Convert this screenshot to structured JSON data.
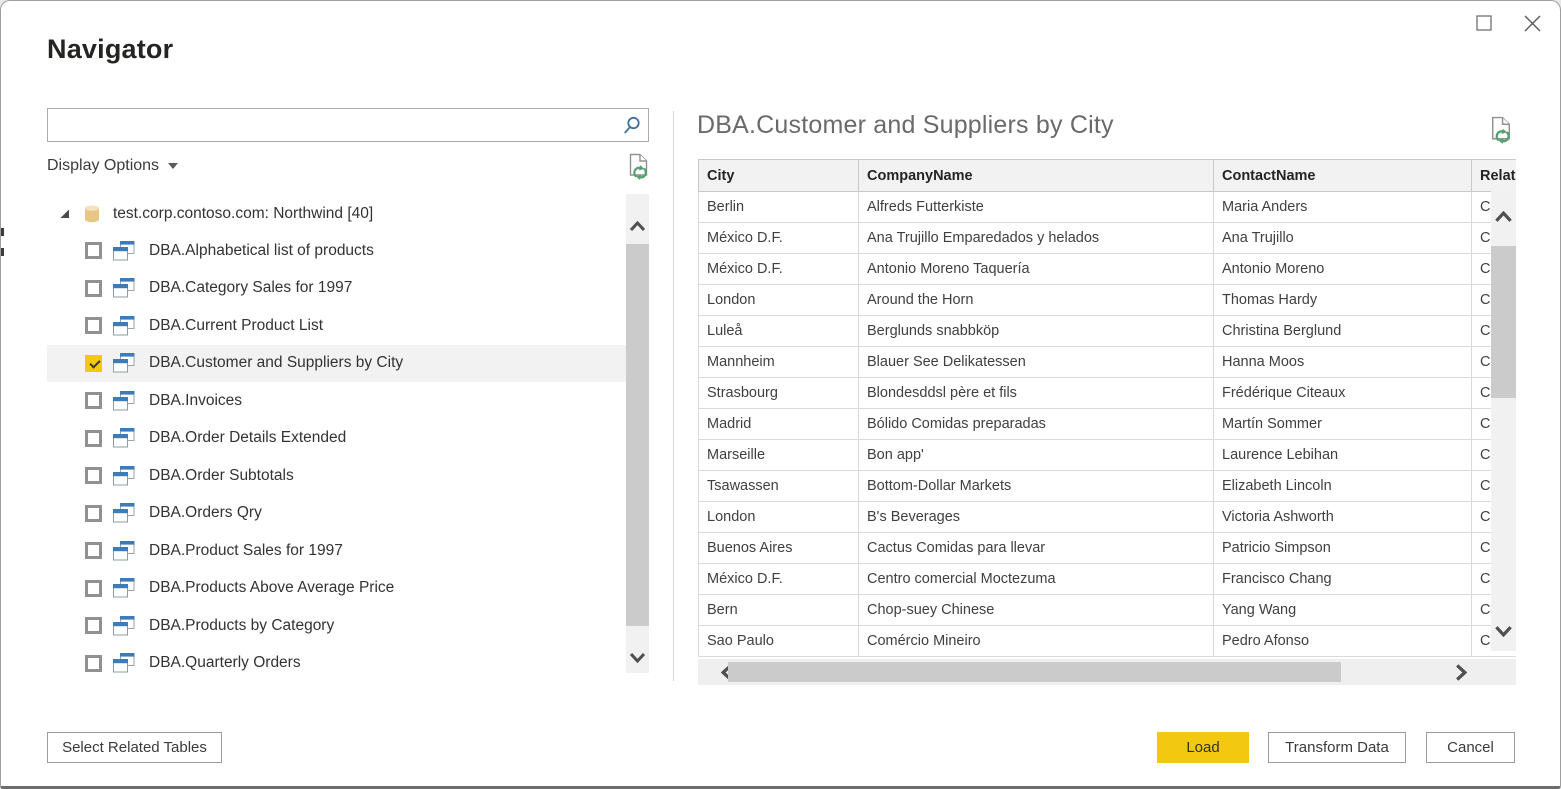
{
  "window": {
    "title": "Navigator"
  },
  "left_panel": {
    "search": {
      "value": "",
      "placeholder": ""
    },
    "display_options_label": "Display Options",
    "tree": {
      "root": {
        "label": "test.corp.contoso.com: Northwind [40]",
        "expanded": true
      },
      "items": [
        {
          "label": "DBA.Alphabetical list of products",
          "checked": false,
          "selected": false
        },
        {
          "label": "DBA.Category Sales for 1997",
          "checked": false,
          "selected": false
        },
        {
          "label": "DBA.Current Product List",
          "checked": false,
          "selected": false
        },
        {
          "label": "DBA.Customer and Suppliers by City",
          "checked": true,
          "selected": true
        },
        {
          "label": "DBA.Invoices",
          "checked": false,
          "selected": false
        },
        {
          "label": "DBA.Order Details Extended",
          "checked": false,
          "selected": false
        },
        {
          "label": "DBA.Order Subtotals",
          "checked": false,
          "selected": false
        },
        {
          "label": "DBA.Orders Qry",
          "checked": false,
          "selected": false
        },
        {
          "label": "DBA.Product Sales for 1997",
          "checked": false,
          "selected": false
        },
        {
          "label": "DBA.Products Above Average Price",
          "checked": false,
          "selected": false
        },
        {
          "label": "DBA.Products by Category",
          "checked": false,
          "selected": false
        },
        {
          "label": "DBA.Quarterly Orders",
          "checked": false,
          "selected": false
        }
      ]
    }
  },
  "preview": {
    "title": "DBA.Customer and Suppliers by City",
    "table": {
      "columns": [
        "City",
        "CompanyName",
        "ContactName",
        "Relati"
      ],
      "rows": [
        [
          "Berlin",
          "Alfreds Futterkiste",
          "Maria Anders",
          "Cu"
        ],
        [
          "México D.F.",
          "Ana Trujillo Emparedados y helados",
          "Ana Trujillo",
          "Cu"
        ],
        [
          "México D.F.",
          "Antonio Moreno Taquería",
          "Antonio Moreno",
          "Cu"
        ],
        [
          "London",
          "Around the Horn",
          "Thomas Hardy",
          "Cu"
        ],
        [
          "Luleå",
          "Berglunds snabbköp",
          "Christina Berglund",
          "Cu"
        ],
        [
          "Mannheim",
          "Blauer See Delikatessen",
          "Hanna Moos",
          "Cu"
        ],
        [
          "Strasbourg",
          "Blondesddsl père et fils",
          "Frédérique Citeaux",
          "Cu"
        ],
        [
          "Madrid",
          "Bólido Comidas preparadas",
          "Martín Sommer",
          "Cu"
        ],
        [
          "Marseille",
          "Bon app'",
          "Laurence Lebihan",
          "Cu"
        ],
        [
          "Tsawassen",
          "Bottom-Dollar Markets",
          "Elizabeth Lincoln",
          "Cu"
        ],
        [
          "London",
          "B's Beverages",
          "Victoria Ashworth",
          "Cu"
        ],
        [
          "Buenos Aires",
          "Cactus Comidas para llevar",
          "Patricio Simpson",
          "Cu"
        ],
        [
          "México D.F.",
          "Centro comercial Moctezuma",
          "Francisco Chang",
          "Cu"
        ],
        [
          "Bern",
          "Chop-suey Chinese",
          "Yang Wang",
          "Cu"
        ],
        [
          "Sao Paulo",
          "Comércio Mineiro",
          "Pedro Afonso",
          "Cu"
        ]
      ]
    }
  },
  "footer": {
    "select_related_label": "Select Related Tables",
    "load_label": "Load",
    "transform_label": "Transform Data",
    "cancel_label": "Cancel"
  },
  "colors": {
    "accent_yellow": "#F2C811",
    "view_icon_blue": "#3E7CB9",
    "refresh_green": "#55A06E",
    "search_blue": "#41719C"
  }
}
